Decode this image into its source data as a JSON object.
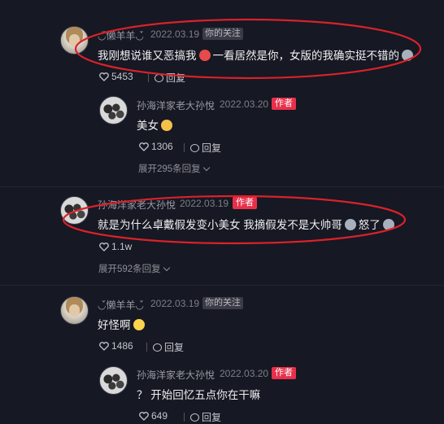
{
  "comments": [
    {
      "user": "◡́̀懒羊羊◡́̀",
      "date": "2022.03.19",
      "badge": "你的关注",
      "text_before": "我刚想说谁又恶搞我",
      "text_after": "一看居然是你，女版的我确实挺不错的",
      "likes": "5453",
      "reply_label": "回复",
      "replies": [
        {
          "user": "孙海洋家老大孙悅",
          "date": "2022.03.20",
          "badge": "作者",
          "text": "美女",
          "likes": "1306",
          "reply_label": "回复"
        }
      ],
      "expand_label": "展开295条回复"
    },
    {
      "user": "孙海洋家老大孙悅",
      "date": "2022.03.19",
      "badge": "作者",
      "text_before": "就是为什么卓戴假发变小美女 我摘假发不是大帅哥",
      "text_after": "怒了",
      "likes": "1.1w",
      "expand_label": "展开592条回复"
    },
    {
      "user": "◡́̀懒羊羊◡́̀",
      "date": "2022.03.19",
      "badge": "你的关注",
      "text_before": "好怪啊",
      "likes": "1486",
      "reply_label": "回复",
      "replies": [
        {
          "user": "孙海洋家老大孙悅",
          "date": "2022.03.20",
          "badge": "作者",
          "text": "？ 开始回忆五点你在干嘛",
          "likes": "649",
          "reply_label": "回复"
        }
      ]
    }
  ],
  "colors": {
    "background": "#161823",
    "author_badge": "#e8304a",
    "highlight_ellipse": "#d9222a"
  }
}
